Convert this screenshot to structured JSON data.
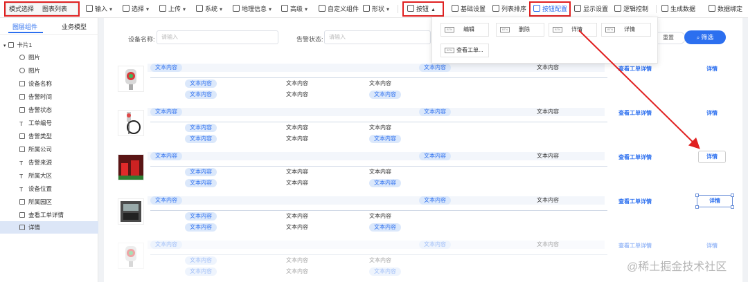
{
  "toolbar": {
    "mode_label": "模式选择",
    "mode_value": "图表列表",
    "items": [
      {
        "label": "输入",
        "icon": "input-icon"
      },
      {
        "label": "选择",
        "icon": "select-icon"
      },
      {
        "label": "上传",
        "icon": "upload-icon"
      },
      {
        "label": "系统",
        "icon": "system-icon"
      },
      {
        "label": "地理信息",
        "icon": "globe-icon"
      },
      {
        "label": "高级",
        "icon": "advanced-icon"
      },
      {
        "label": "自定义组件",
        "icon": "custom-component-icon"
      },
      {
        "label": "形状",
        "icon": "shape-icon"
      },
      {
        "label": "按钮",
        "icon": "button-icon"
      },
      {
        "label": "基础设置",
        "icon": "settings-icon"
      },
      {
        "label": "列表排序",
        "icon": "sort-icon"
      },
      {
        "label": "按钮配置",
        "icon": "button-config-icon"
      },
      {
        "label": "显示设置",
        "icon": "display-icon"
      },
      {
        "label": "逻辑控制",
        "icon": "logic-icon"
      },
      {
        "label": "生成数据",
        "icon": "data-icon"
      },
      {
        "label": "数据绑定",
        "icon": "bind-icon"
      }
    ]
  },
  "sidebar": {
    "tabs": [
      "图层组件",
      "业务模型"
    ],
    "root": "卡片1",
    "items": [
      "图片",
      "图片",
      "设备名称",
      "告警时间",
      "告警状态",
      "工单编号",
      "告警类型",
      "所属公司",
      "告警来源",
      "所属大区",
      "设备位置",
      "所属园区",
      "查看工单详情",
      "详情"
    ]
  },
  "filter": {
    "device_label": "设备名称:",
    "device_placeholder": "请输入",
    "status_label": "告警状态:",
    "status_placeholder": "请输入",
    "reset": "重置",
    "submit": "筛选"
  },
  "popup": {
    "badge": "BTN",
    "items": [
      "编辑",
      "删除",
      "详情",
      "详情",
      "查看工单..."
    ]
  },
  "cards": {
    "text": "文本内容",
    "view_ticket": "查看工单详情",
    "detail": "详情"
  },
  "watermark": "@稀土掘金技术社区"
}
